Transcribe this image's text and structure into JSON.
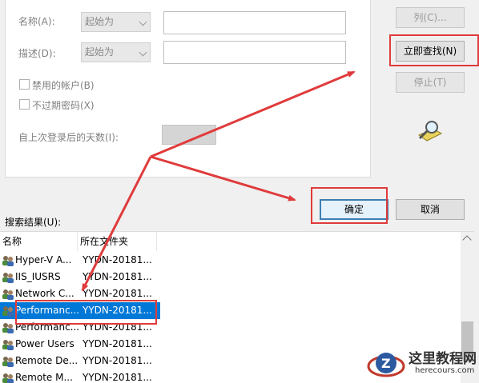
{
  "query": {
    "name_label": "名称(A):",
    "name_mode": "起始为",
    "desc_label": "描述(D):",
    "desc_mode": "起始为",
    "disabled_accounts": "禁用的帐户(B)",
    "non_expiring_pw": "不过期密码(X)",
    "days_since_logon": "自上次登录后的天数(I):"
  },
  "buttons": {
    "columns": "列(C)...",
    "find_now": "立即查找(N)",
    "stop": "停止(T)",
    "ok": "确定",
    "cancel": "取消"
  },
  "results": {
    "label": "搜索结果(U):",
    "col_name": "名称",
    "col_folder": "所在文件夹",
    "rows": [
      {
        "name": "Hyper-V A...",
        "folder": "YYDN-20181..."
      },
      {
        "name": "IIS_IUSRS",
        "folder": "YYDN-20181..."
      },
      {
        "name": "Network C...",
        "folder": "YYDN-20181..."
      },
      {
        "name": "Performanc...",
        "folder": "YYDN-20181..."
      },
      {
        "name": "Performanc...",
        "folder": "YYDN-20181..."
      },
      {
        "name": "Power Users",
        "folder": "YYDN-20181..."
      },
      {
        "name": "Remote De...",
        "folder": "YYDN-20181..."
      },
      {
        "name": "Remote M...",
        "folder": "YYDN-20181..."
      }
    ],
    "selected_index": 3
  },
  "watermark": {
    "title": "这里教程网",
    "url": "herecours.com"
  },
  "colors": {
    "accent": "#0078d7",
    "highlight": "#e03b3b"
  }
}
